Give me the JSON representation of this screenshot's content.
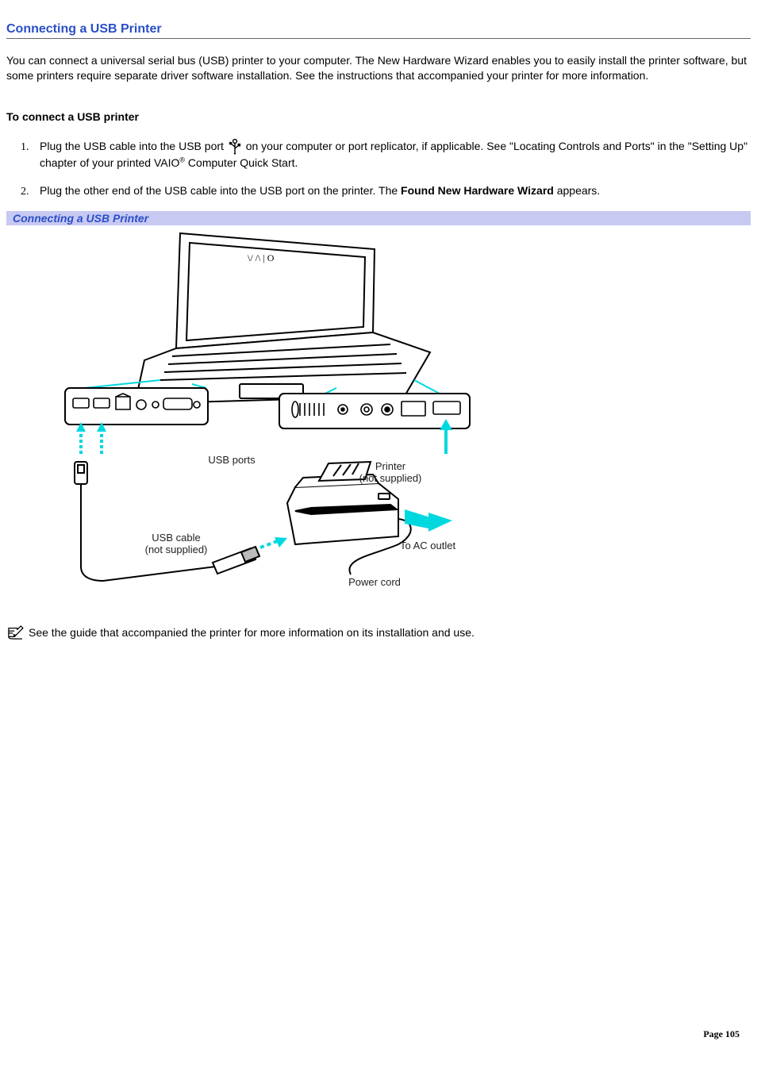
{
  "heading": "Connecting a USB Printer",
  "intro": "You can connect a universal serial bus (USB) printer to your computer. The New Hardware Wizard enables you to easily install the printer software, but some printers require separate driver software installation. See the instructions that accompanied your printer for more information.",
  "subheading": "To connect a USB printer",
  "steps": {
    "s1_a": "Plug the USB cable into the USB port ",
    "s1_b": " on your computer or port replicator, if applicable. See \"Locating Controls and Ports\" in the \"Setting Up\" chapter of your printed VAIO",
    "s1_reg": "®",
    "s1_c": " Computer Quick Start.",
    "s2_a": "Plug the other end of the USB cable into the USB port on the printer. The ",
    "s2_bold": "Found New Hardware Wizard",
    "s2_b": " appears."
  },
  "figure": {
    "caption": "Connecting a USB Printer",
    "labels": {
      "usb_ports": "USB ports",
      "printer": "Printer",
      "printer_sub": "(not supplied)",
      "usb_cable": "USB cable",
      "usb_cable_sub": "(not supplied)",
      "to_ac": "To AC outlet",
      "power_cord": "Power cord"
    }
  },
  "note": "See the guide that accompanied the printer for more information on its installation and use.",
  "footer": {
    "label": "Page",
    "number": "105"
  }
}
